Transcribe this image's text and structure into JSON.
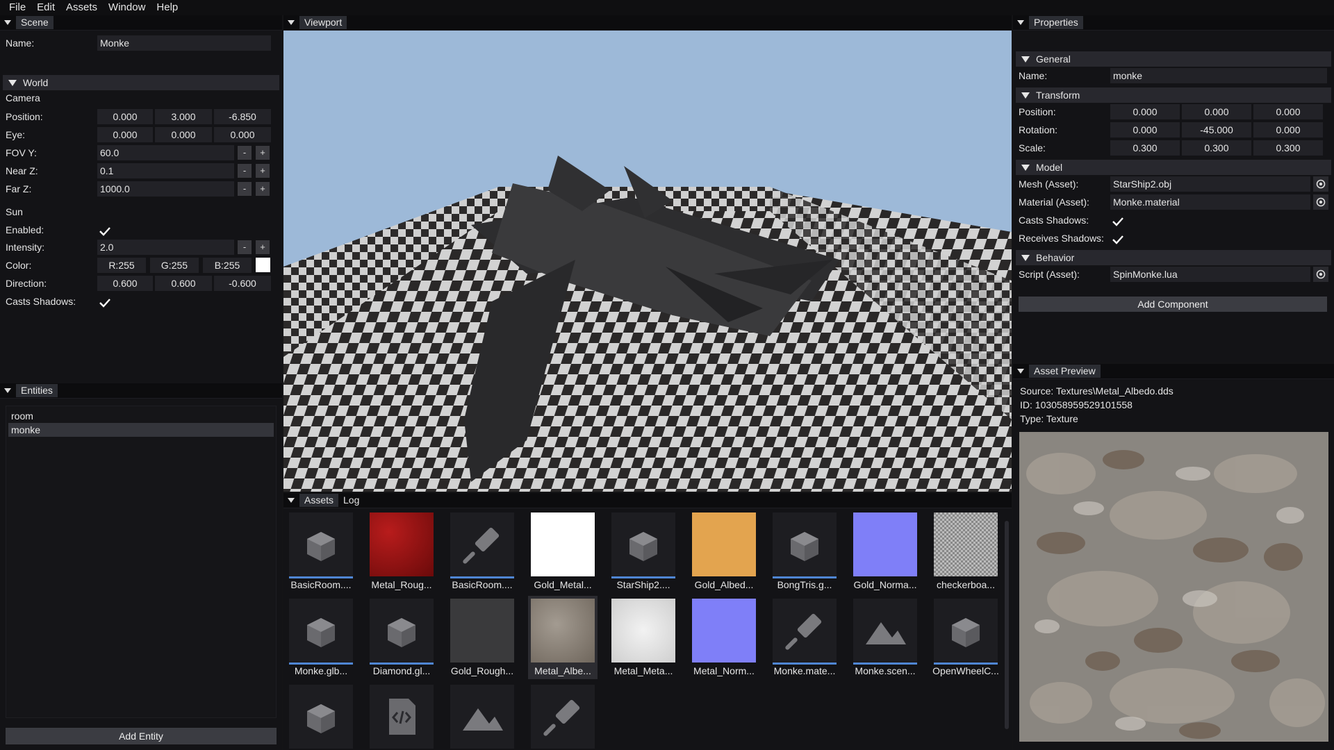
{
  "menu": [
    "File",
    "Edit",
    "Assets",
    "Window",
    "Help"
  ],
  "scene": {
    "tab": "Scene",
    "name_label": "Name:",
    "name_value": "Monke",
    "world_label": "World",
    "camera_label": "Camera",
    "position_label": "Position:",
    "position": [
      "0.000",
      "3.000",
      "-6.850"
    ],
    "eye_label": "Eye:",
    "eye": [
      "0.000",
      "0.000",
      "0.000"
    ],
    "fovy_label": "FOV Y:",
    "fovy": "60.0",
    "nearz_label": "Near Z:",
    "nearz": "0.1",
    "farz_label": "Far Z:",
    "farz": "1000.0",
    "minus": "-",
    "plus": "+",
    "sun_label": "Sun",
    "enabled_label": "Enabled:",
    "intensity_label": "Intensity:",
    "intensity": "2.0",
    "color_label": "Color:",
    "color": [
      "R:255",
      "G:255",
      "B:255"
    ],
    "color_swatch": "#ffffff",
    "direction_label": "Direction:",
    "direction": [
      "0.600",
      "0.600",
      "-0.600"
    ],
    "casts_label": "Casts Shadows:"
  },
  "entities": {
    "tab": "Entities",
    "items": [
      "room",
      "monke"
    ],
    "add_button": "Add Entity"
  },
  "viewport": {
    "tab": "Viewport"
  },
  "assets": {
    "tabs": [
      "Assets",
      "Log"
    ],
    "items": [
      {
        "name": "BasicRoom....",
        "kind": "cube-icon"
      },
      {
        "name": "Metal_Roug...",
        "kind": "texture-red"
      },
      {
        "name": "BasicRoom....",
        "kind": "brush-icon"
      },
      {
        "name": "Gold_Metal...",
        "kind": "texture-white"
      },
      {
        "name": "StarShip2....",
        "kind": "cube-icon"
      },
      {
        "name": "Gold_Albed...",
        "kind": "texture-gold"
      },
      {
        "name": "BongTris.g...",
        "kind": "cube-icon"
      },
      {
        "name": "Gold_Norma...",
        "kind": "texture-normal"
      },
      {
        "name": "checkerboa...",
        "kind": "texture-checker"
      },
      {
        "name": "Monke.glb...",
        "kind": "cube-icon"
      },
      {
        "name": "Diamond.gl...",
        "kind": "cube-icon"
      },
      {
        "name": "Gold_Rough...",
        "kind": "texture-darkgray"
      },
      {
        "name": "Metal_Albe...",
        "kind": "texture-stone"
      },
      {
        "name": "Metal_Meta...",
        "kind": "texture-lightgray"
      },
      {
        "name": "Metal_Norm...",
        "kind": "texture-normal"
      },
      {
        "name": "Monke.mate...",
        "kind": "brush-icon"
      },
      {
        "name": "Monke.scen...",
        "kind": "mountain-icon"
      },
      {
        "name": "OpenWheelC...",
        "kind": "cube-icon"
      },
      {
        "name": "",
        "kind": "cube-icon"
      },
      {
        "name": "",
        "kind": "code-file-icon"
      },
      {
        "name": "",
        "kind": "mountain-icon"
      },
      {
        "name": "",
        "kind": "brush-icon"
      }
    ]
  },
  "properties": {
    "tab": "Properties",
    "general": "General",
    "name_label": "Name:",
    "name_value": "monke",
    "transform": "Transform",
    "position_label": "Position:",
    "position": [
      "0.000",
      "0.000",
      "0.000"
    ],
    "rotation_label": "Rotation:",
    "rotation": [
      "0.000",
      "-45.000",
      "0.000"
    ],
    "scale_label": "Scale:",
    "scale": [
      "0.300",
      "0.300",
      "0.300"
    ],
    "model": "Model",
    "mesh_label": "Mesh (Asset):",
    "mesh_value": "StarShip2.obj",
    "material_label": "Material (Asset):",
    "material_value": "Monke.material",
    "casts_label": "Casts Shadows:",
    "receives_label": "Receives Shadows:",
    "behavior": "Behavior",
    "script_label": "Script (Asset):",
    "script_value": "SpinMonke.lua",
    "add_component": "Add Component"
  },
  "preview": {
    "tab": "Asset Preview",
    "source": "Source: Textures\\Metal_Albedo.dds",
    "id": "ID: 1030589595291015​58",
    "type": "Type: Texture"
  },
  "colors": {
    "accent": "#4f86d4",
    "sky": "#9db9d8"
  }
}
